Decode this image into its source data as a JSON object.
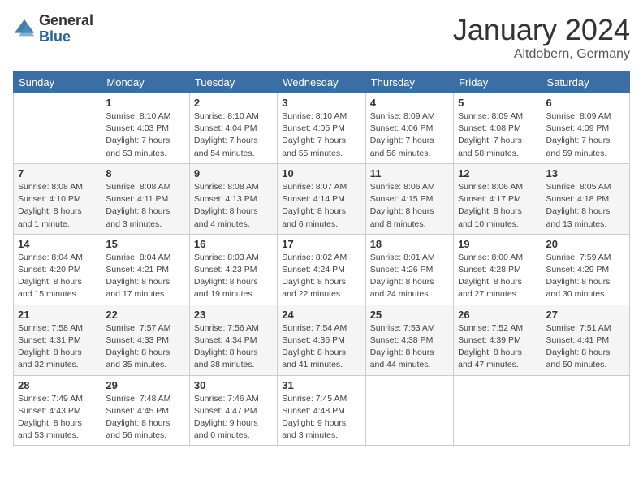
{
  "header": {
    "logo": {
      "general": "General",
      "blue": "Blue"
    },
    "title": "January 2024",
    "location": "Altdobern, Germany"
  },
  "calendar": {
    "days_of_week": [
      "Sunday",
      "Monday",
      "Tuesday",
      "Wednesday",
      "Thursday",
      "Friday",
      "Saturday"
    ],
    "weeks": [
      [
        {
          "day": "",
          "info": ""
        },
        {
          "day": "1",
          "info": "Sunrise: 8:10 AM\nSunset: 4:03 PM\nDaylight: 7 hours\nand 53 minutes."
        },
        {
          "day": "2",
          "info": "Sunrise: 8:10 AM\nSunset: 4:04 PM\nDaylight: 7 hours\nand 54 minutes."
        },
        {
          "day": "3",
          "info": "Sunrise: 8:10 AM\nSunset: 4:05 PM\nDaylight: 7 hours\nand 55 minutes."
        },
        {
          "day": "4",
          "info": "Sunrise: 8:09 AM\nSunset: 4:06 PM\nDaylight: 7 hours\nand 56 minutes."
        },
        {
          "day": "5",
          "info": "Sunrise: 8:09 AM\nSunset: 4:08 PM\nDaylight: 7 hours\nand 58 minutes."
        },
        {
          "day": "6",
          "info": "Sunrise: 8:09 AM\nSunset: 4:09 PM\nDaylight: 7 hours\nand 59 minutes."
        }
      ],
      [
        {
          "day": "7",
          "info": "Sunrise: 8:08 AM\nSunset: 4:10 PM\nDaylight: 8 hours\nand 1 minute."
        },
        {
          "day": "8",
          "info": "Sunrise: 8:08 AM\nSunset: 4:11 PM\nDaylight: 8 hours\nand 3 minutes."
        },
        {
          "day": "9",
          "info": "Sunrise: 8:08 AM\nSunset: 4:13 PM\nDaylight: 8 hours\nand 4 minutes."
        },
        {
          "day": "10",
          "info": "Sunrise: 8:07 AM\nSunset: 4:14 PM\nDaylight: 8 hours\nand 6 minutes."
        },
        {
          "day": "11",
          "info": "Sunrise: 8:06 AM\nSunset: 4:15 PM\nDaylight: 8 hours\nand 8 minutes."
        },
        {
          "day": "12",
          "info": "Sunrise: 8:06 AM\nSunset: 4:17 PM\nDaylight: 8 hours\nand 10 minutes."
        },
        {
          "day": "13",
          "info": "Sunrise: 8:05 AM\nSunset: 4:18 PM\nDaylight: 8 hours\nand 13 minutes."
        }
      ],
      [
        {
          "day": "14",
          "info": "Sunrise: 8:04 AM\nSunset: 4:20 PM\nDaylight: 8 hours\nand 15 minutes."
        },
        {
          "day": "15",
          "info": "Sunrise: 8:04 AM\nSunset: 4:21 PM\nDaylight: 8 hours\nand 17 minutes."
        },
        {
          "day": "16",
          "info": "Sunrise: 8:03 AM\nSunset: 4:23 PM\nDaylight: 8 hours\nand 19 minutes."
        },
        {
          "day": "17",
          "info": "Sunrise: 8:02 AM\nSunset: 4:24 PM\nDaylight: 8 hours\nand 22 minutes."
        },
        {
          "day": "18",
          "info": "Sunrise: 8:01 AM\nSunset: 4:26 PM\nDaylight: 8 hours\nand 24 minutes."
        },
        {
          "day": "19",
          "info": "Sunrise: 8:00 AM\nSunset: 4:28 PM\nDaylight: 8 hours\nand 27 minutes."
        },
        {
          "day": "20",
          "info": "Sunrise: 7:59 AM\nSunset: 4:29 PM\nDaylight: 8 hours\nand 30 minutes."
        }
      ],
      [
        {
          "day": "21",
          "info": "Sunrise: 7:58 AM\nSunset: 4:31 PM\nDaylight: 8 hours\nand 32 minutes."
        },
        {
          "day": "22",
          "info": "Sunrise: 7:57 AM\nSunset: 4:33 PM\nDaylight: 8 hours\nand 35 minutes."
        },
        {
          "day": "23",
          "info": "Sunrise: 7:56 AM\nSunset: 4:34 PM\nDaylight: 8 hours\nand 38 minutes."
        },
        {
          "day": "24",
          "info": "Sunrise: 7:54 AM\nSunset: 4:36 PM\nDaylight: 8 hours\nand 41 minutes."
        },
        {
          "day": "25",
          "info": "Sunrise: 7:53 AM\nSunset: 4:38 PM\nDaylight: 8 hours\nand 44 minutes."
        },
        {
          "day": "26",
          "info": "Sunrise: 7:52 AM\nSunset: 4:39 PM\nDaylight: 8 hours\nand 47 minutes."
        },
        {
          "day": "27",
          "info": "Sunrise: 7:51 AM\nSunset: 4:41 PM\nDaylight: 8 hours\nand 50 minutes."
        }
      ],
      [
        {
          "day": "28",
          "info": "Sunrise: 7:49 AM\nSunset: 4:43 PM\nDaylight: 8 hours\nand 53 minutes."
        },
        {
          "day": "29",
          "info": "Sunrise: 7:48 AM\nSunset: 4:45 PM\nDaylight: 8 hours\nand 56 minutes."
        },
        {
          "day": "30",
          "info": "Sunrise: 7:46 AM\nSunset: 4:47 PM\nDaylight: 9 hours\nand 0 minutes."
        },
        {
          "day": "31",
          "info": "Sunrise: 7:45 AM\nSunset: 4:48 PM\nDaylight: 9 hours\nand 3 minutes."
        },
        {
          "day": "",
          "info": ""
        },
        {
          "day": "",
          "info": ""
        },
        {
          "day": "",
          "info": ""
        }
      ]
    ]
  }
}
